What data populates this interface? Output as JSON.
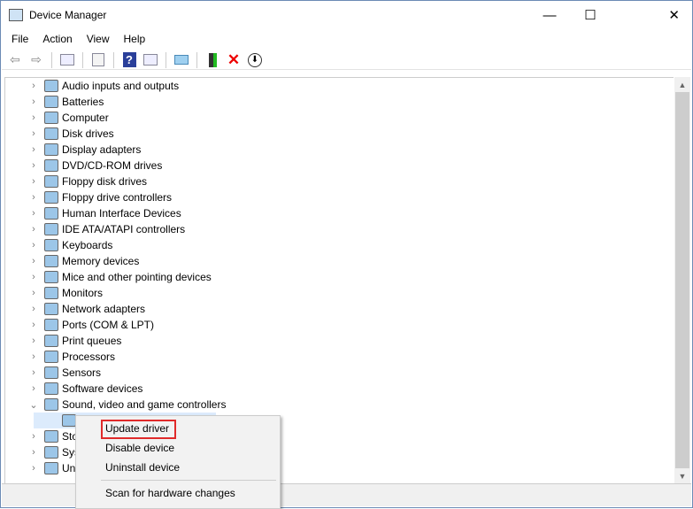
{
  "window": {
    "title": "Device Manager",
    "minimize": "—",
    "maximize": "☐",
    "close": "✕"
  },
  "menubar": [
    "File",
    "Action",
    "View",
    "Help"
  ],
  "toolbar": {
    "icons": [
      "back-icon",
      "forward-icon",
      "show-hide-console-tree-icon",
      "properties-icon",
      "help-icon",
      "action-pane-icon",
      "scan-hardware-icon",
      "update-driver-icon",
      "uninstall-icon",
      "disable-icon"
    ]
  },
  "tree": [
    {
      "label": "Audio inputs and outputs",
      "expanded": false
    },
    {
      "label": "Batteries",
      "expanded": false
    },
    {
      "label": "Computer",
      "expanded": false
    },
    {
      "label": "Disk drives",
      "expanded": false
    },
    {
      "label": "Display adapters",
      "expanded": false
    },
    {
      "label": "DVD/CD-ROM drives",
      "expanded": false
    },
    {
      "label": "Floppy disk drives",
      "expanded": false
    },
    {
      "label": "Floppy drive controllers",
      "expanded": false
    },
    {
      "label": "Human Interface Devices",
      "expanded": false
    },
    {
      "label": "IDE ATA/ATAPI controllers",
      "expanded": false
    },
    {
      "label": "Keyboards",
      "expanded": false
    },
    {
      "label": "Memory devices",
      "expanded": false
    },
    {
      "label": "Mice and other pointing devices",
      "expanded": false
    },
    {
      "label": "Monitors",
      "expanded": false
    },
    {
      "label": "Network adapters",
      "expanded": false
    },
    {
      "label": "Ports (COM & LPT)",
      "expanded": false
    },
    {
      "label": "Print queues",
      "expanded": false
    },
    {
      "label": "Processors",
      "expanded": false
    },
    {
      "label": "Sensors",
      "expanded": false
    },
    {
      "label": "Software devices",
      "expanded": false
    },
    {
      "label": "Sound, video and game controllers",
      "expanded": true
    },
    {
      "label": "",
      "child": true
    },
    {
      "label": "Sto",
      "expanded": false
    },
    {
      "label": "Sys",
      "expanded": false
    },
    {
      "label": "Uni",
      "expanded": false
    }
  ],
  "context_menu": {
    "items": [
      "Update driver",
      "Disable device",
      "Uninstall device",
      "Scan for hardware changes"
    ],
    "highlight_color": "#e02a2a"
  }
}
